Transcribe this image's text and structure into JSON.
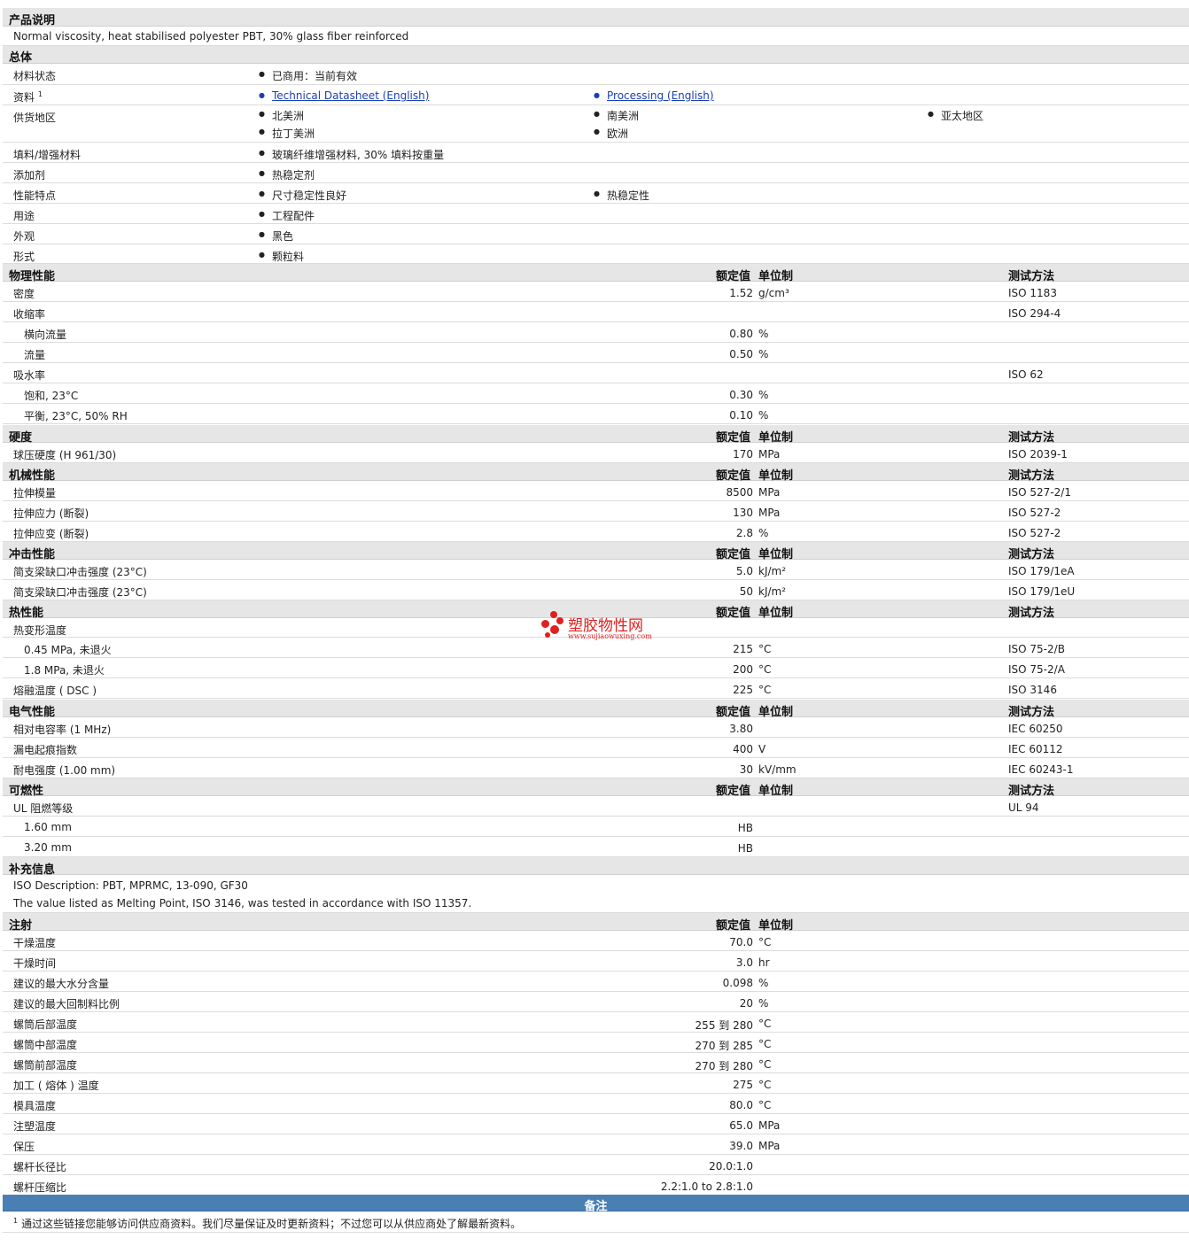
{
  "desc": {
    "title": "产品说明",
    "text": "Normal viscosity, heat stabilised polyester PBT, 30% glass fiber reinforced"
  },
  "general": {
    "title": "总体",
    "status_label": "材料状态",
    "status": "已商用：当前有效",
    "docs_label": "资料",
    "docs_sup": "1",
    "docs": [
      "Technical Datasheet (English)",
      "Processing (English)"
    ],
    "regions_label": "供货地区",
    "regions": [
      "北美洲",
      "南美洲",
      "亚太地区",
      "拉丁美洲",
      "欧洲"
    ],
    "filler_label": "填料/增强材料",
    "filler": "玻璃纤维增强材料, 30% 填料按重量",
    "additive_label": "添加剂",
    "additive": "热稳定剂",
    "features_label": "性能特点",
    "features": [
      "尺寸稳定性良好",
      "热稳定性"
    ],
    "uses_label": "用途",
    "uses": "工程配件",
    "appearance_label": "外观",
    "appearance": "黑色",
    "form_label": "形式",
    "form": "颗粒料"
  },
  "headers": {
    "value": "额定值",
    "unit": "单位制",
    "method": "测试方法"
  },
  "physical": {
    "title": "物理性能",
    "rows": [
      {
        "label": "密度",
        "value": "1.52",
        "unit": "g/cm³",
        "method": "ISO 1183"
      },
      {
        "label": "收缩率",
        "value": "",
        "unit": "",
        "method": "ISO 294-4"
      },
      {
        "label": "横向流量",
        "value": "0.80",
        "unit": "%",
        "method": ""
      },
      {
        "label": "流量",
        "value": "0.50",
        "unit": "%",
        "method": ""
      },
      {
        "label": "吸水率",
        "value": "",
        "unit": "",
        "method": "ISO 62"
      },
      {
        "label": "饱和, 23°C",
        "value": "0.30",
        "unit": "%",
        "method": ""
      },
      {
        "label": "平衡, 23°C, 50% RH",
        "value": "0.10",
        "unit": "%",
        "method": ""
      }
    ]
  },
  "hardness": {
    "title": "硬度",
    "rows": [
      {
        "label": "球压硬度 (H 961/30)",
        "value": "170",
        "unit": "MPa",
        "method": "ISO 2039-1"
      }
    ]
  },
  "mechanical": {
    "title": "机械性能",
    "rows": [
      {
        "label": "拉伸模量",
        "value": "8500",
        "unit": "MPa",
        "method": "ISO 527-2/1"
      },
      {
        "label": "拉伸应力 (断裂)",
        "value": "130",
        "unit": "MPa",
        "method": "ISO 527-2"
      },
      {
        "label": "拉伸应变 (断裂)",
        "value": "2.8",
        "unit": "%",
        "method": "ISO 527-2"
      }
    ]
  },
  "impact": {
    "title": "冲击性能",
    "rows": [
      {
        "label": "简支梁缺口冲击强度 (23°C)",
        "value": "5.0",
        "unit": "kJ/m²",
        "method": "ISO 179/1eA"
      },
      {
        "label": "简支梁缺口冲击强度 (23°C)",
        "value": "50",
        "unit": "kJ/m²",
        "method": "ISO 179/1eU"
      }
    ]
  },
  "thermal": {
    "title": "热性能",
    "rows": [
      {
        "label": "热变形温度",
        "value": "",
        "unit": "",
        "method": ""
      },
      {
        "label": "0.45 MPa, 未退火",
        "value": "215",
        "unit": "°C",
        "method": "ISO 75-2/B"
      },
      {
        "label": "1.8 MPa, 未退火",
        "value": "200",
        "unit": "°C",
        "method": "ISO 75-2/A"
      },
      {
        "label": "熔融温度 ( DSC )",
        "value": "225",
        "unit": "°C",
        "method": "ISO 3146"
      }
    ]
  },
  "electrical": {
    "title": "电气性能",
    "rows": [
      {
        "label": "相对电容率 (1 MHz)",
        "value": "3.80",
        "unit": "",
        "method": "IEC 60250"
      },
      {
        "label": "漏电起痕指数",
        "value": "400",
        "unit": "V",
        "method": "IEC 60112"
      },
      {
        "label": "耐电强度 (1.00 mm)",
        "value": "30",
        "unit": "kV/mm",
        "method": "IEC 60243-1"
      }
    ]
  },
  "flammability": {
    "title": "可燃性",
    "rows": [
      {
        "label": "UL 阻燃等级",
        "value": "",
        "unit": "",
        "method": "UL 94"
      },
      {
        "label": "1.60 mm",
        "value": "HB",
        "unit": "",
        "method": ""
      },
      {
        "label": "3.20 mm",
        "value": "HB",
        "unit": "",
        "method": ""
      }
    ]
  },
  "supplement": {
    "title": "补充信息",
    "lines": [
      "ISO Description: PBT, MPRMC, 13-090, GF30",
      "The value listed as Melting Point, ISO 3146, was tested in accordance with ISO 11357."
    ]
  },
  "injection": {
    "title": "注射",
    "rows": [
      {
        "label": "干燥温度",
        "value": "70.0",
        "unit": "°C"
      },
      {
        "label": "干燥时间",
        "value": "3.0",
        "unit": "hr"
      },
      {
        "label": "建议的最大水分含量",
        "value": "0.098",
        "unit": "%"
      },
      {
        "label": "建议的最大回制料比例",
        "value": "20",
        "unit": "%"
      },
      {
        "label": "螺筒后部温度",
        "value": "255 到  280",
        "unit": "°C"
      },
      {
        "label": "螺筒中部温度",
        "value": "270 到  285",
        "unit": "°C"
      },
      {
        "label": "螺筒前部温度",
        "value": "270 到  280",
        "unit": "°C"
      },
      {
        "label": "加工 ( 熔体 ) 温度",
        "value": "275",
        "unit": "°C"
      },
      {
        "label": "模具温度",
        "value": "80.0",
        "unit": "°C"
      },
      {
        "label": "注塑温度",
        "value": "65.0",
        "unit": "MPa"
      },
      {
        "label": "保压",
        "value": "39.0",
        "unit": "MPa"
      },
      {
        "label": "螺杆长径比",
        "value": "20.0:1.0",
        "unit": ""
      },
      {
        "label": "螺杆压缩比",
        "value": "2.2:1.0 to 2.8:1.0",
        "unit": ""
      }
    ]
  },
  "notes": {
    "title": "备注",
    "sup": "1",
    "text": "通过这些链接您能够访问供应商资料。我们尽量保证及时更新资料；不过您可以从供应商处了解最新资料。"
  },
  "watermark": {
    "name": "塑胶物性网",
    "url": "www.sujiaowuxing.com",
    "color": "#e02020"
  },
  "colors": {
    "section_bg": "#e6e6e6",
    "notes_bar": "#4a7fb4",
    "link": "#1a3fb8"
  }
}
